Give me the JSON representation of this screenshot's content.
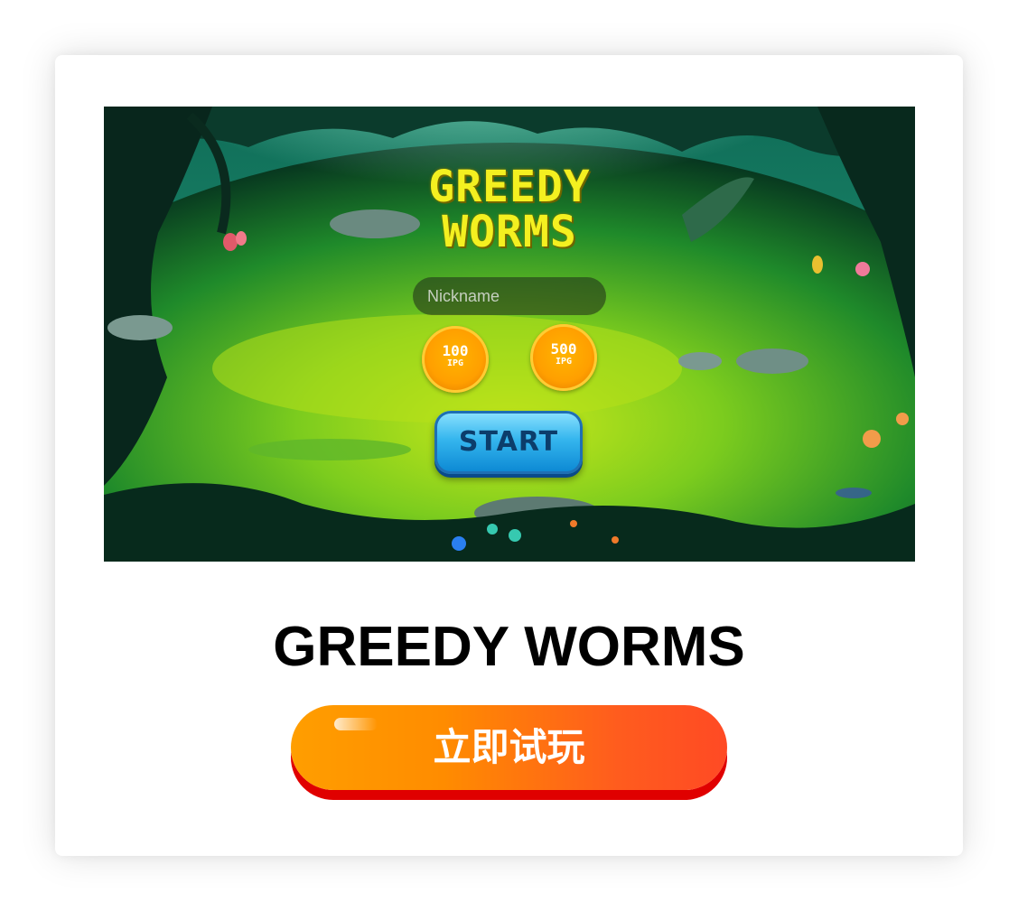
{
  "game": {
    "logo_line1": "GREEDY",
    "logo_line2": "WORMS",
    "nickname_placeholder": "Nickname",
    "stakes": [
      {
        "amount": "100",
        "currency": "IPG"
      },
      {
        "amount": "500",
        "currency": "IPG"
      }
    ],
    "start_label": "START"
  },
  "card": {
    "title": "GREEDY WORMS",
    "play_label": "立即试玩"
  },
  "colors": {
    "logo": "#f4f020",
    "coin": "#ff9f00",
    "start_button": "#35b6ee",
    "play_button_start": "#ff9e00",
    "play_button_end": "#ff4a24"
  }
}
